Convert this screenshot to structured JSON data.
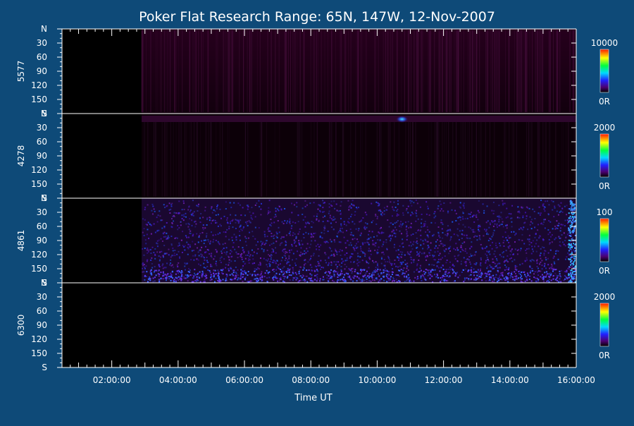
{
  "title": "Poker Flat Research Range: 65N, 147W, 12-Nov-2007",
  "colors": {
    "background": "#0e4a78",
    "plot_background": "#000000",
    "axis": "#ffffff",
    "text": "#ffffff"
  },
  "chart_data": {
    "type": "heatmap",
    "title": "Poker Flat Research Range: 65N, 147W, 12-Nov-2007",
    "xlabel": "Time UT",
    "x_ticks": [
      "02:00:00",
      "04:00:00",
      "06:00:00",
      "08:00:00",
      "10:00:00",
      "12:00:00",
      "14:00:00",
      "16:00:00"
    ],
    "x_tick_values": [
      2,
      4,
      6,
      8,
      10,
      12,
      14,
      16
    ],
    "xlim": [
      0.5,
      16.0
    ],
    "data_start_ut": 2.9,
    "colormap": "rainbow (black-purple-blue-cyan-green-yellow-red)",
    "y_ticks": [
      "N",
      "30",
      "60",
      "90",
      "120",
      "150",
      "S"
    ],
    "y_tick_values": [
      0,
      30,
      60,
      90,
      120,
      150,
      180
    ],
    "ylim": [
      0,
      180
    ],
    "panels": [
      {
        "name": "5577",
        "colorbar_max_label": "10000",
        "colorbar_min_label": "0R",
        "cmax": 10000,
        "feature": "faint vertical streaks across the full time range"
      },
      {
        "name": "4278",
        "colorbar_max_label": "2000",
        "colorbar_min_label": "0R",
        "cmax": 2000,
        "feature": "faint band near north horizon with bright spot near 10:45 UT"
      },
      {
        "name": "4861",
        "colorbar_max_label": "100",
        "colorbar_min_label": "0R",
        "cmax": 100,
        "feature": "purple-blue noise throughout, brighter near south and at 16:00 UT"
      },
      {
        "name": "6300",
        "colorbar_max_label": "2000",
        "colorbar_min_label": "0R",
        "cmax": 2000,
        "feature": "no data (black)"
      }
    ]
  }
}
